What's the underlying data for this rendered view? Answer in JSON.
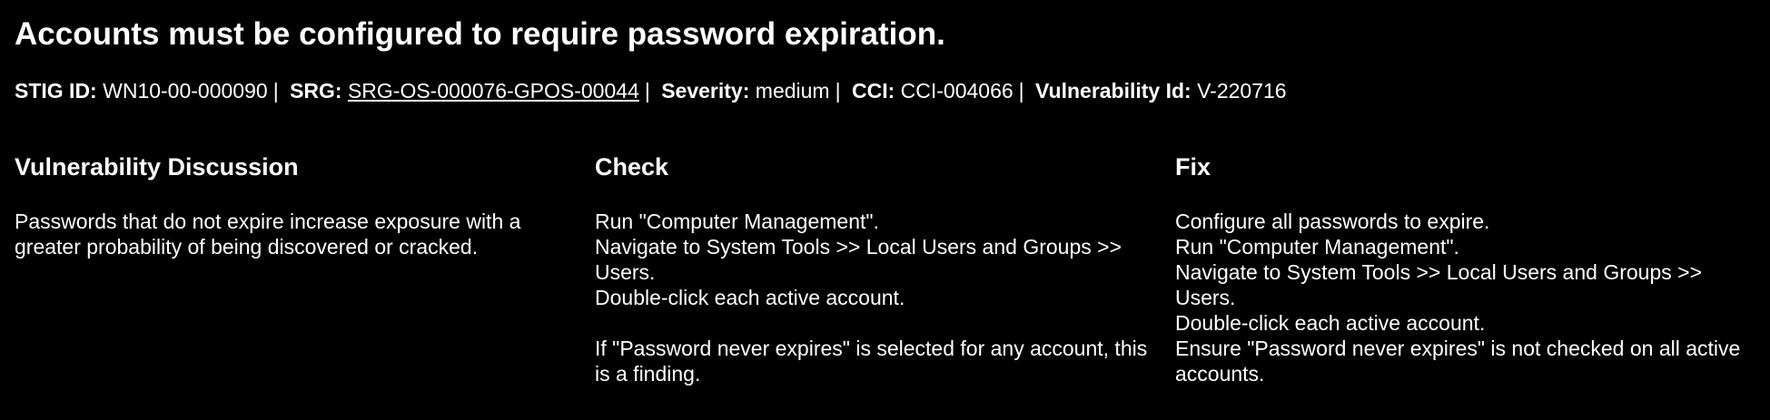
{
  "title": "Accounts must be configured to require password expiration.",
  "meta": {
    "stig_label": "STIG ID:",
    "stig_value": "WN10-00-000090",
    "srg_label": "SRG:",
    "srg_value": "SRG-OS-000076-GPOS-00044",
    "severity_label": "Severity:",
    "severity_value": "medium",
    "cci_label": "CCI:",
    "cci_value": "CCI-004066",
    "vuln_label": "Vulnerability Id:",
    "vuln_value": "V-220716"
  },
  "discussion": {
    "heading": "Vulnerability Discussion",
    "line1": "Passwords that do not expire increase exposure with a greater probability of being discovered or cracked."
  },
  "check": {
    "heading": "Check",
    "line1": "Run \"Computer Management\".",
    "line2": "Navigate to System Tools >> Local Users and Groups >> Users.",
    "line3": "Double-click each active account.",
    "line4": "If \"Password never expires\" is selected for any account, this is a finding."
  },
  "fix": {
    "heading": "Fix",
    "line1": "Configure all passwords to expire.",
    "line2": "Run \"Computer Management\".",
    "line3": "Navigate to System Tools >> Local Users and Groups >> Users.",
    "line4": "Double-click each active account.",
    "line5": "Ensure \"Password never expires\" is not checked on all active accounts."
  }
}
